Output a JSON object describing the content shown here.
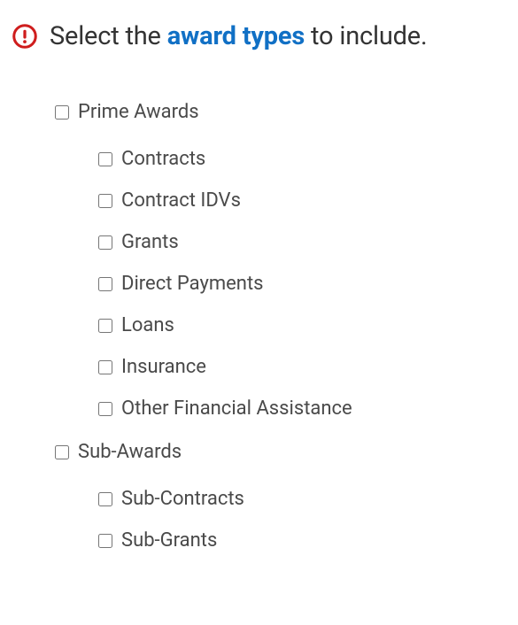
{
  "header": {
    "prefix": "Select the ",
    "highlight": "award types",
    "suffix": " to include."
  },
  "groups": [
    {
      "label": "Prime Awards",
      "children": [
        {
          "label": "Contracts"
        },
        {
          "label": "Contract IDVs"
        },
        {
          "label": "Grants"
        },
        {
          "label": "Direct Payments"
        },
        {
          "label": "Loans"
        },
        {
          "label": "Insurance"
        },
        {
          "label": "Other Financial Assistance"
        }
      ]
    },
    {
      "label": "Sub-Awards",
      "children": [
        {
          "label": "Sub-Contracts"
        },
        {
          "label": "Sub-Grants"
        }
      ]
    }
  ]
}
